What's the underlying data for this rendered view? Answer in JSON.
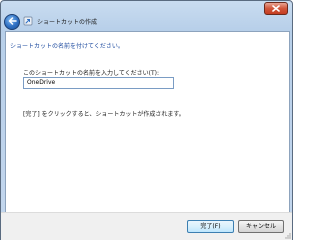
{
  "window": {
    "title": "ショートカットの作成",
    "close_icon": "close-icon",
    "back_icon": "back-arrow-icon"
  },
  "page": {
    "heading": "ショートカットの名前を付けてください。",
    "name_label": "このショートカットの名前を入力してください(T):",
    "name_value": "OneDrive",
    "info_text": "[完了] をクリックすると、ショートカットが作成されます。"
  },
  "footer": {
    "finish_label": "完了(F)",
    "cancel_label": "キャンセル"
  },
  "colors": {
    "heading": "#1f4ca0",
    "close_button": "#c43d22",
    "frame": "#b7cfe9"
  }
}
